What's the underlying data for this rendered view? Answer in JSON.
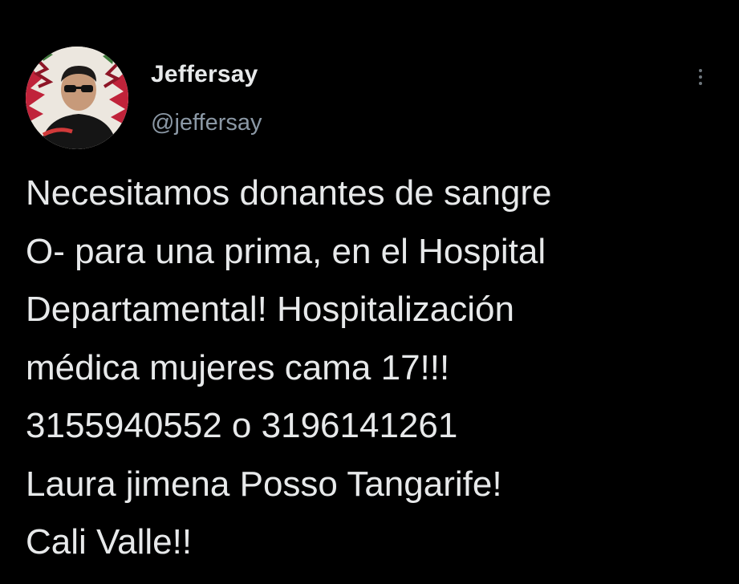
{
  "tweet": {
    "author": {
      "display_name": "Jeffersay",
      "handle": "@jeffersay",
      "avatar_icon": "profile-photo"
    },
    "more_icon": "more-vertical-icon",
    "lines": [
      "Necesitamos donantes de sangre",
      "O- para una prima, en el Hospital",
      "Departamental! Hospitalización",
      "médica mujeres cama 17!!!",
      "3155940552 o 3196141261",
      "Laura jimena Posso Tangarife!",
      "Cali Valle!!"
    ]
  },
  "colors": {
    "background": "#000000",
    "primary_text": "#e7e9ea",
    "secondary_text": "#8b98a5",
    "icon": "#6e767d"
  }
}
